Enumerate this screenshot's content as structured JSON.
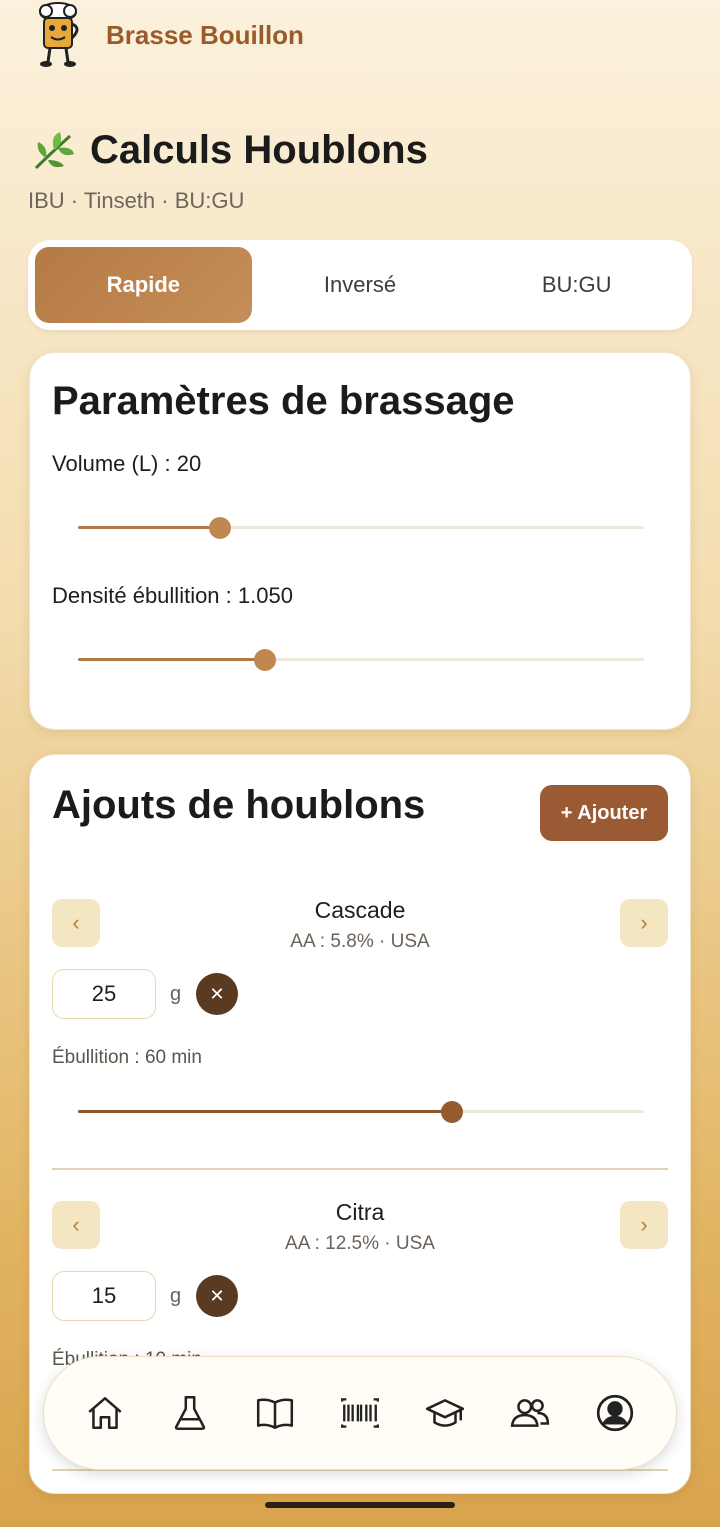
{
  "header": {
    "brand": "Brasse Bouillon"
  },
  "page": {
    "title": "Calculs Houblons",
    "subtitle": "IBU · Tinseth · BU:GU"
  },
  "tabs": [
    {
      "label": "Rapide",
      "active": true
    },
    {
      "label": "Inversé",
      "active": false
    },
    {
      "label": "BU:GU",
      "active": false
    }
  ],
  "params": {
    "title": "Paramètres de brassage",
    "volume_label": "Volume (L) : 20",
    "volume_value": 0.25,
    "density_label": "Densité ébullition : 1.050",
    "density_value": 0.33
  },
  "hops": {
    "title": "Ajouts de houblons",
    "add_label": "+ Ajouter",
    "prev_glyph": "‹",
    "next_glyph": "›",
    "remove_glyph": "✕",
    "items": [
      {
        "name": "Cascade",
        "meta": "AA : 5.8% · USA",
        "qty": "25",
        "unit": "g",
        "boil_label": "Ébullition : 60 min",
        "boil_value": 0.66
      },
      {
        "name": "Citra",
        "meta": "AA : 12.5% · USA",
        "qty": "15",
        "unit": "g",
        "boil_label": "Ébullition : 10 min"
      }
    ]
  },
  "bottom_nav": {
    "items": [
      "home-icon",
      "flask-icon",
      "book-icon",
      "barcode-icon",
      "graduation-cap-icon",
      "users-icon",
      "profile-icon"
    ]
  },
  "colors": {
    "accent": "#b57a44",
    "dark": "#5b3a22",
    "brand": "#9a5a2a"
  }
}
